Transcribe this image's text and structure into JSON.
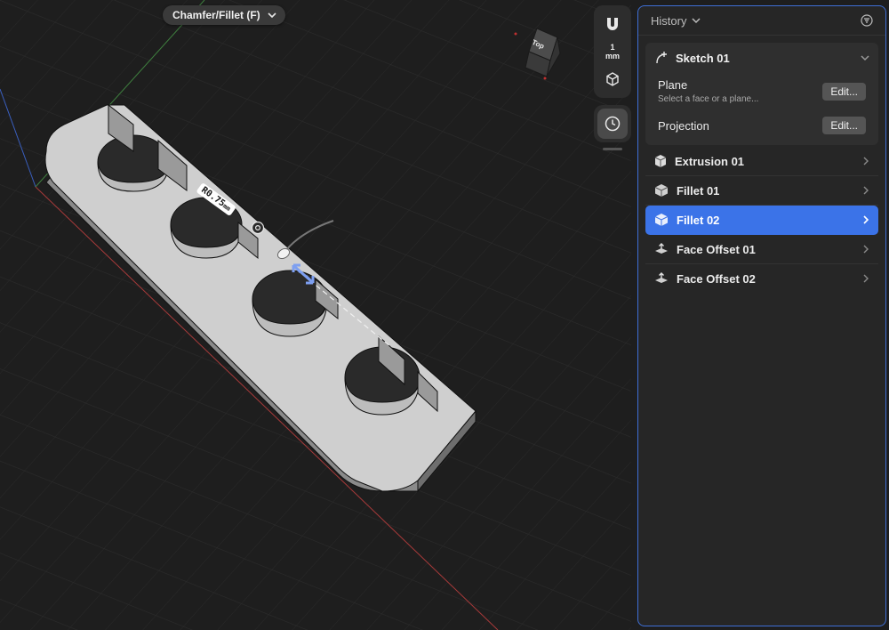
{
  "tool": {
    "label": "Chamfer/Fillet (F)",
    "chevron_icon": "chevron-down-icon"
  },
  "dimension": {
    "value": "R0.75",
    "unit": "mm"
  },
  "view_cube": {
    "face_label": "Top"
  },
  "toolbar": {
    "units_value": "1",
    "units_label": "mm"
  },
  "history": {
    "title": "History",
    "sketch": {
      "label": "Sketch 01",
      "plane": {
        "label": "Plane",
        "hint": "Select a face or a plane...",
        "edit_label": "Edit..."
      },
      "projection": {
        "label": "Projection",
        "edit_label": "Edit..."
      }
    },
    "items": [
      {
        "label": "Extrusion 01",
        "icon": "extrusion-icon",
        "selected": false
      },
      {
        "label": "Fillet 01",
        "icon": "fillet-icon",
        "selected": false
      },
      {
        "label": "Fillet 02",
        "icon": "fillet-icon",
        "selected": true
      },
      {
        "label": "Face Offset 01",
        "icon": "face-offset-icon",
        "selected": false
      },
      {
        "label": "Face Offset 02",
        "icon": "face-offset-icon",
        "selected": false
      }
    ]
  },
  "colors": {
    "accent": "#3b73e8",
    "panel_border": "#3e6fd6",
    "viewport_bg": "#1e1e1e"
  }
}
